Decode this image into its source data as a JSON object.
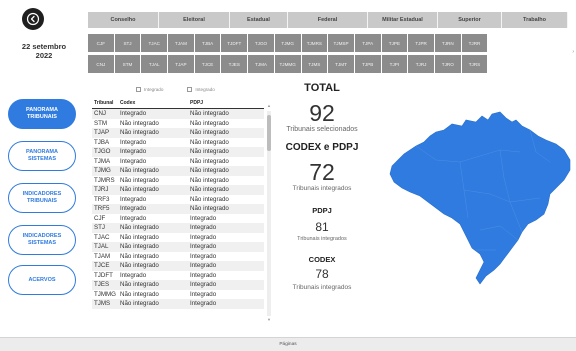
{
  "date": {
    "line1": "22 setembro",
    "line2": "2022"
  },
  "nav": [
    {
      "label": "PANORAMA TRIBUNAIS",
      "active": true
    },
    {
      "label": "PANORAMA SISTEMAS",
      "active": false
    },
    {
      "label": "INDICADORES TRIBUNAIS",
      "active": false
    },
    {
      "label": "INDICADORES SISTEMAS",
      "active": false
    },
    {
      "label": "ACERVOS",
      "active": false
    }
  ],
  "categories": [
    "Conselho",
    "Eleitoral",
    "Estadual",
    "Federal",
    "Militar Estadual",
    "Superior",
    "Trabalho"
  ],
  "tiles": [
    [
      "CJF",
      "STJ",
      "TJAC",
      "TJAM",
      "TJBA",
      "TJDFT",
      "TJGO",
      "TJMG",
      "TJMRS",
      "TJMSP",
      "TJPA",
      "TJPE",
      "TJPR",
      "TJRN",
      "TJRR"
    ],
    [
      "CNJ",
      "STM",
      "TJAL",
      "TJAP",
      "TJCE",
      "TJES",
      "TJMA",
      "TJMMG",
      "TJMS",
      "TJMT",
      "TJPB",
      "TJPI",
      "TJRJ",
      "TJRO",
      "TJRS"
    ]
  ],
  "legend": {
    "integrado": "Integrado",
    "nao_integrado": "Integrado"
  },
  "table": {
    "headers": [
      "Tribunal",
      "Codex",
      "PDPJ"
    ],
    "rows": [
      [
        "CNJ",
        "Integrado",
        "Não integrado"
      ],
      [
        "STM",
        "Não integrado",
        "Não integrado"
      ],
      [
        "TJAP",
        "Não integrado",
        "Não integrado"
      ],
      [
        "TJBA",
        "Integrado",
        "Não integrado"
      ],
      [
        "TJGO",
        "Integrado",
        "Não integrado"
      ],
      [
        "TJMA",
        "Integrado",
        "Não integrado"
      ],
      [
        "TJMG",
        "Não integrado",
        "Não integrado"
      ],
      [
        "TJMRS",
        "Não integrado",
        "Não integrado"
      ],
      [
        "TJRJ",
        "Não integrado",
        "Não integrado"
      ],
      [
        "TRF3",
        "Integrado",
        "Não integrado"
      ],
      [
        "TRF5",
        "Integrado",
        "Não integrado"
      ],
      [
        "CJF",
        "Integrado",
        "Integrado"
      ],
      [
        "STJ",
        "Não integrado",
        "Integrado"
      ],
      [
        "TJAC",
        "Não integrado",
        "Integrado"
      ],
      [
        "TJAL",
        "Não integrado",
        "Integrado"
      ],
      [
        "TJAM",
        "Não integrado",
        "Integrado"
      ],
      [
        "TJCE",
        "Não integrado",
        "Integrado"
      ],
      [
        "TJDFT",
        "Integrado",
        "Integrado"
      ],
      [
        "TJES",
        "Não integrado",
        "Integrado"
      ],
      [
        "TJMMG",
        "Não integrado",
        "Integrado"
      ],
      [
        "TJMS",
        "Não integrado",
        "Integrado"
      ]
    ]
  },
  "stats": {
    "total_title": "TOTAL",
    "total_value": "92",
    "total_sub": "Tribunais selecionados",
    "codex_pdpj_title": "CODEX e PDPJ",
    "codex_pdpj_value": "72",
    "codex_pdpj_sub": "Tribunais integrados",
    "pdpj_title": "PDPJ",
    "pdpj_value": "81",
    "pdpj_sub": "Tribunais integrados",
    "codex_title": "CODEX",
    "codex_value": "78",
    "codex_sub": "Tribunais integrados"
  },
  "footer": {
    "pages_label": "Páginas"
  },
  "colors": {
    "accent": "#2f7be0",
    "map": "#2f7be0",
    "tile": "#8c8c8c",
    "category": "#c9c9c9"
  }
}
